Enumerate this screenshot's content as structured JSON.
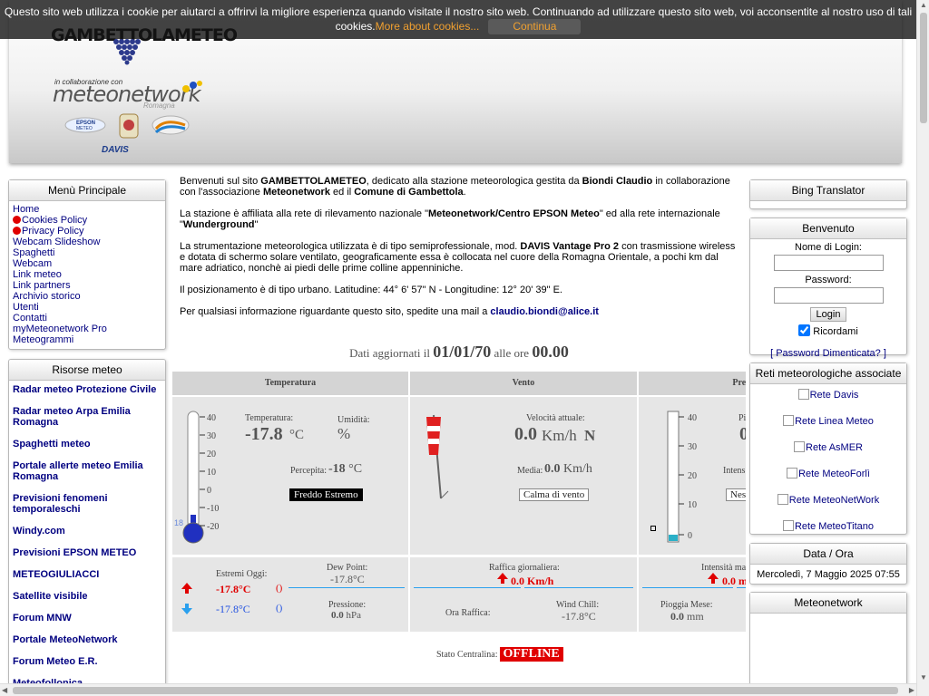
{
  "cookie": {
    "message": "Questo sito web utilizza i cookie per aiutarci a offrirvi la migliore esperienza quando visitate il nostro sito web. Continuando ad utilizzare questo sito web, voi acconsentite al nostro uso di tali cookies.",
    "more_link": "More about cookies...",
    "continue_label": "Continua"
  },
  "header": {
    "site_logo": "GAMBETTOLAMETEO",
    "collab_text": "in collaborazione con",
    "network_logo": "meteonetwork",
    "network_sub": "Romagna",
    "epson_logo": "EPSON METEO",
    "davis_logo": "DAVIS"
  },
  "left_menu": {
    "title": "Menù Principale",
    "items": [
      "Home",
      "Cookies Policy",
      "Privacy Policy",
      "Webcam Slideshow",
      "Spaghetti",
      "Webcam",
      "Link meteo",
      "Link partners",
      "Archivio storico",
      "Utenti",
      "Contatti",
      "myMeteonetwork Pro",
      "Meteogrammi"
    ]
  },
  "resources": {
    "title": "Risorse meteo",
    "items": [
      "Radar meteo Protezione Civile",
      "Radar meteo Arpa Emilia Romagna",
      "Spaghetti meteo",
      "Portale allerte meteo Emilia Romagna",
      "Previsioni fenomeni temporaleschi",
      "Windy.com",
      "Previsioni EPSON METEO",
      "METEOGIULIACCI",
      "Satellite visibile",
      "Forum MNW",
      "Portale MeteoNetwork",
      "Forum Meteo E.R.",
      "Meteofollonica"
    ]
  },
  "intro": {
    "p1_a": "Benvenuti sul sito ",
    "p1_site": "GAMBETTOLAMETEO",
    "p1_b": ", dedicato alla stazione meteorologica gestita da ",
    "p1_owner": "Biondi Claudio",
    "p1_c": " in collaborazione con l'associazione ",
    "p1_assoc": "Meteonetwork",
    "p1_d": " ed il ",
    "p1_comune": "Comune di Gambettola",
    "p1_e": ".",
    "p2_a": "La stazione è affiliata alla rete di rilevamento nazionale \"",
    "p2_net": "Meteonetwork/Centro EPSON Meteo",
    "p2_b": "\" ed alla rete internazionale \"",
    "p2_wu": "Wunderground",
    "p2_c": "\"",
    "p3_a": "La strumentazione meteorologica utilizzata è di tipo semiprofessionale, mod. ",
    "p3_model": "DAVIS Vantage Pro 2",
    "p3_b": " con trasmissione wireless e dotata di schermo solare ventilato, geograficamente essa è collocata nel cuore della Romagna Orientale, a pochi km dal mare adriatico, nonchè ai piedi delle prime colline appenniniche.",
    "p4": "Il posizionamento è di tipo urbano. Latitudine: 44° 6' 57\" N - Longitudine: 12° 20' 39\" E.",
    "p5_a": "Per qualsiasi informazione riguardante questo sito, spedite una mail a ",
    "p5_email": "claudio.biondi@alice.it"
  },
  "updated": {
    "prefix": "Dati aggiornati il",
    "date": "01/01/70",
    "mid": "alle ore",
    "time": "00.00"
  },
  "weather": {
    "headers": [
      "Temperatura",
      "Vento",
      "Precipitaz"
    ],
    "temp": {
      "label": "Temperatura:",
      "value": "-17.8",
      "unit": "°C",
      "hum_label": "Umidità:",
      "hum_unit": "%",
      "perc_label": "Percepita:",
      "perc_value": "-18",
      "perc_unit": "°C",
      "badge": "Freddo Estremo",
      "scale": [
        "40",
        "30",
        "20",
        "10",
        "0",
        "-10",
        "-20"
      ],
      "fill_fraction": 0.03
    },
    "wind": {
      "speed_label": "Velocità attuale:",
      "speed_value": "0.0",
      "speed_unit": "Km/h",
      "dir": "N",
      "avg_label": "Media:",
      "avg_value": "0.0",
      "avg_unit": "Km/h",
      "badge": "Calma di vento"
    },
    "rain": {
      "label_partial": "Pi",
      "value_partial": "0",
      "int_partial": "Intens",
      "badge_partial": "Nes",
      "scale": [
        "40",
        "30",
        "20",
        "10",
        "0"
      ]
    },
    "extremes": {
      "label": "Estremi Oggi:",
      "max": "-17.8°C",
      "max_time": "()",
      "min": "-17.8°C",
      "min_time": "()",
      "dew_label": "Dew Point:",
      "dew_value": "-17.8°C",
      "press_label": "Pressione:",
      "press_value": "0.0",
      "press_unit": "hPa"
    },
    "gust": {
      "label": "Raffica giornaliera:",
      "value": "0.0 Km/h",
      "time_label": "Ora Raffica:",
      "chill_label": "Wind Chill:",
      "chill_value": "-17.8°C"
    },
    "rain2": {
      "int_label": "Intensità ma",
      "int_value": "0.0 m",
      "month_label": "Pioggia Mese:",
      "month_value": "0.0",
      "month_unit": "mm"
    }
  },
  "status": {
    "label": "Stato Centralina:",
    "value": "OFFLINE"
  },
  "right": {
    "bing_title": "Bing Translator",
    "welcome_title": "Benvenuto",
    "login_label": "Nome di Login:",
    "password_label": "Password:",
    "login_button": "Login",
    "remember_label": "Ricordami",
    "forgot_link": "[ Password Dimenticata? ]",
    "networks_title": "Reti meteorologiche associate",
    "networks": [
      "Rete Davis",
      "Rete Linea Meteo",
      "Rete AsMER",
      "Rete MeteoForlì",
      "Rete MeteoNetWork",
      "Rete MeteoTitano"
    ],
    "datetime_title": "Data / Ora",
    "datetime_value": "Mercoledì, 7 Maggio 2025 07:55",
    "mn_title": "Meteonetwork"
  },
  "colors": {
    "link": "#000080",
    "alert_red": "#e00000",
    "min_blue": "#2050e0",
    "accent_cyan": "#2aa0ee"
  }
}
